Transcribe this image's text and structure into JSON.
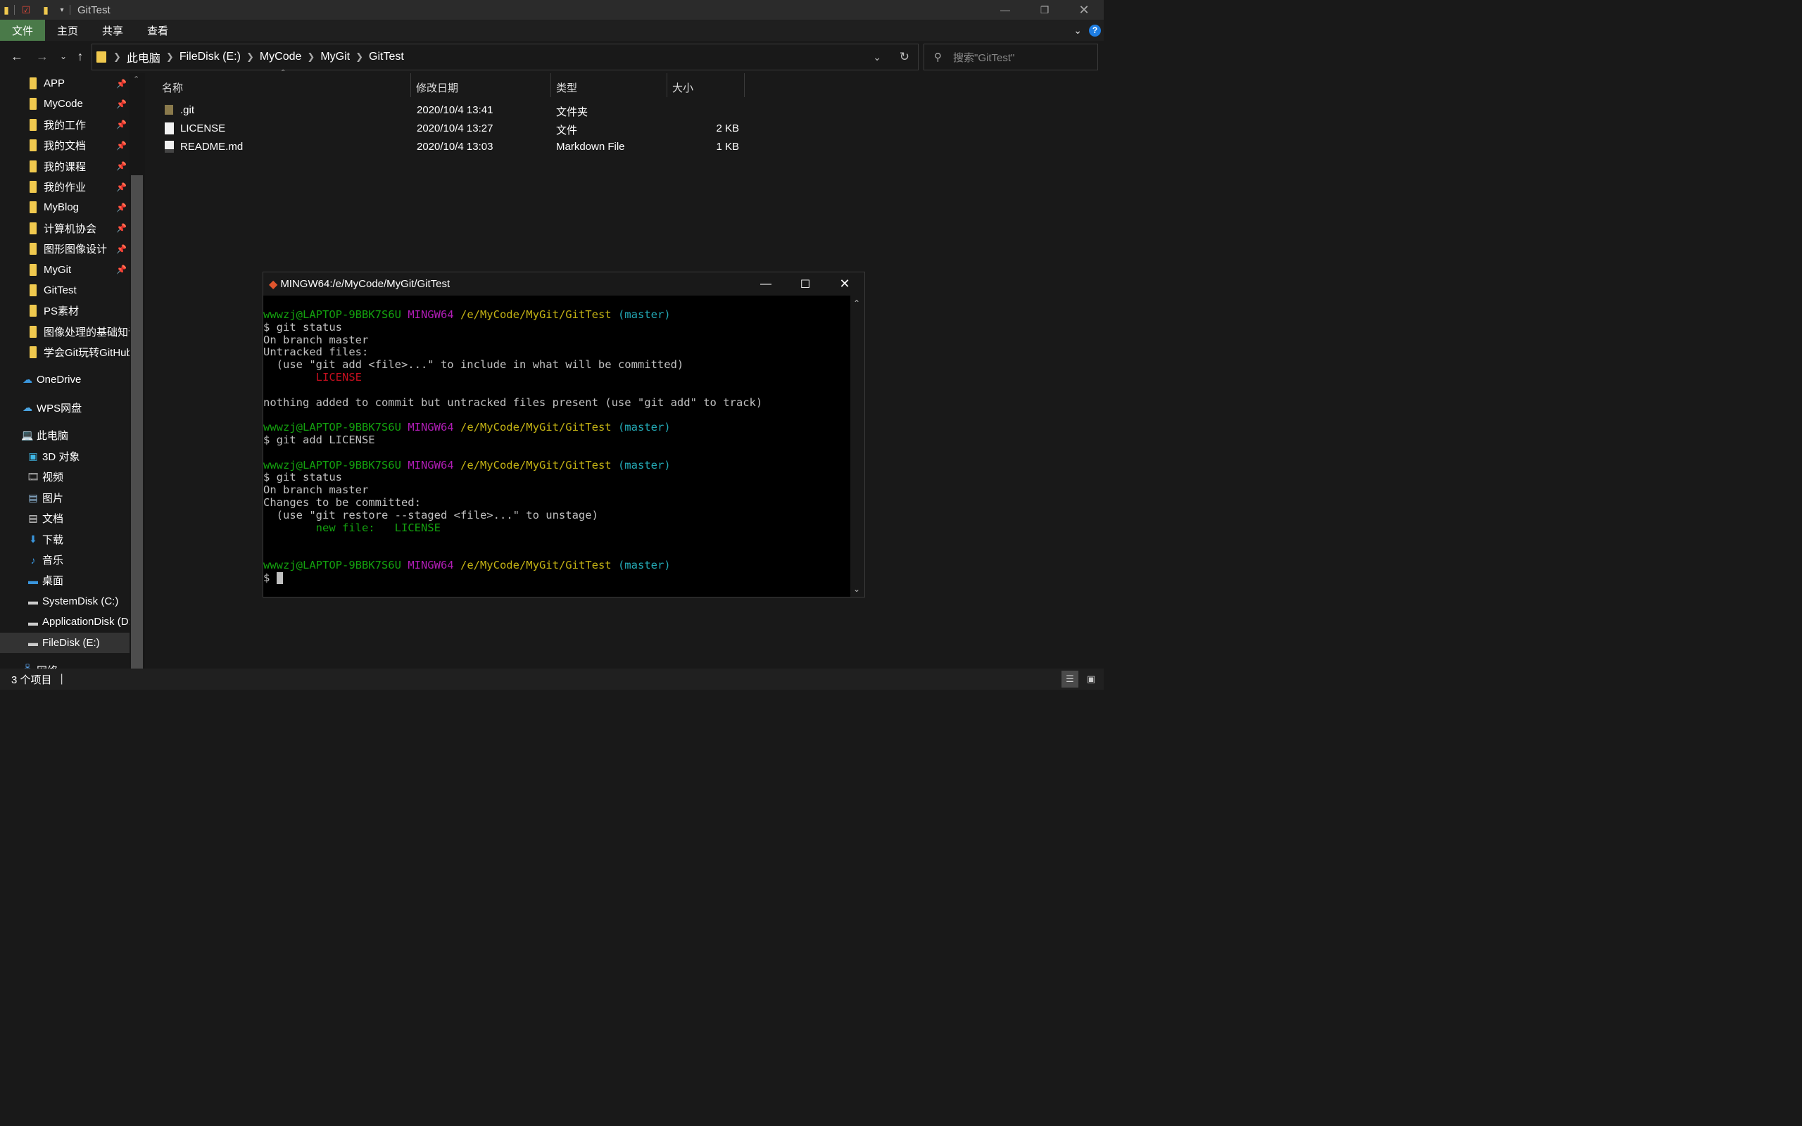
{
  "window": {
    "title": "GitTest",
    "controls": [
      "minimize-icon",
      "restore-icon",
      "close-icon"
    ]
  },
  "ribbon": {
    "tabs": [
      {
        "label": "文件",
        "active": true
      },
      {
        "label": "主页",
        "active": false
      },
      {
        "label": "共享",
        "active": false
      },
      {
        "label": "查看",
        "active": false
      }
    ]
  },
  "address": {
    "crumbs": [
      "此电脑",
      "FileDisk (E:)",
      "MyCode",
      "MyGit",
      "GitTest"
    ],
    "search_placeholder": "搜索\"GitTest\""
  },
  "sidebar": {
    "quick_access": [
      {
        "label": "APP",
        "pinned": true
      },
      {
        "label": "MyCode",
        "pinned": true
      },
      {
        "label": "我的工作",
        "pinned": true
      },
      {
        "label": "我的文档",
        "pinned": true
      },
      {
        "label": "我的课程",
        "pinned": true
      },
      {
        "label": "我的作业",
        "pinned": true
      },
      {
        "label": "MyBlog",
        "pinned": true
      },
      {
        "label": "计算机协会",
        "pinned": true
      },
      {
        "label": "图形图像设计",
        "pinned": true
      },
      {
        "label": "MyGit",
        "pinned": true
      },
      {
        "label": "GitTest",
        "pinned": false
      },
      {
        "label": "PS素材",
        "pinned": false
      },
      {
        "label": "图像处理的基础知识",
        "pinned": false
      },
      {
        "label": "学会Git玩转GitHub",
        "pinned": false
      }
    ],
    "onedrive": "OneDrive",
    "wps": "WPS网盘",
    "this_pc": "此电脑",
    "pc_items": [
      {
        "label": "3D 对象",
        "icon": "cube-3d-icon"
      },
      {
        "label": "视频",
        "icon": "video-icon"
      },
      {
        "label": "图片",
        "icon": "picture-icon"
      },
      {
        "label": "文档",
        "icon": "document-icon"
      },
      {
        "label": "下载",
        "icon": "download-icon"
      },
      {
        "label": "音乐",
        "icon": "music-icon"
      },
      {
        "label": "桌面",
        "icon": "desktop-icon"
      },
      {
        "label": "SystemDisk (C:)",
        "icon": "drive-icon"
      },
      {
        "label": "ApplicationDisk (D:)",
        "icon": "drive-icon"
      },
      {
        "label": "FileDisk (E:)",
        "icon": "drive-icon",
        "selected": true
      }
    ],
    "network": "网络"
  },
  "filelist": {
    "headers": {
      "name": "名称",
      "date": "修改日期",
      "type": "类型",
      "size": "大小"
    },
    "rows": [
      {
        "name": ".git",
        "date": "2020/10/4 13:41",
        "type": "文件夹",
        "size": "",
        "icon": "folder-icon"
      },
      {
        "name": "LICENSE",
        "date": "2020/10/4 13:27",
        "type": "文件",
        "size": "2 KB",
        "icon": "file-icon"
      },
      {
        "name": "README.md",
        "date": "2020/10/4 13:03",
        "type": "Markdown File",
        "size": "1 KB",
        "icon": "markdown-file-icon"
      }
    ]
  },
  "terminal": {
    "title": "MINGW64:/e/MyCode/MyGit/GitTest",
    "prompt": {
      "user": "wwwzj@LAPTOP-9BBK7S6U",
      "env": "MINGW64",
      "path": "/e/MyCode/MyGit/GitTest",
      "branch": "(master)"
    },
    "lines": [
      {
        "kind": "prompt"
      },
      {
        "kind": "text",
        "text": "$ git status"
      },
      {
        "kind": "text",
        "text": "On branch master"
      },
      {
        "kind": "text",
        "text": "Untracked files:"
      },
      {
        "kind": "text",
        "text": "  (use \"git add <file>...\" to include in what will be committed)"
      },
      {
        "kind": "red",
        "text": "        LICENSE"
      },
      {
        "kind": "text",
        "text": ""
      },
      {
        "kind": "text",
        "text": "nothing added to commit but untracked files present (use \"git add\" to track)"
      },
      {
        "kind": "text",
        "text": ""
      },
      {
        "kind": "prompt"
      },
      {
        "kind": "text",
        "text": "$ git add LICENSE"
      },
      {
        "kind": "text",
        "text": ""
      },
      {
        "kind": "prompt"
      },
      {
        "kind": "text",
        "text": "$ git status"
      },
      {
        "kind": "text",
        "text": "On branch master"
      },
      {
        "kind": "text",
        "text": "Changes to be committed:"
      },
      {
        "kind": "text",
        "text": "  (use \"git restore --staged <file>...\" to unstage)"
      },
      {
        "kind": "green",
        "text": "        new file:   LICENSE"
      },
      {
        "kind": "text",
        "text": ""
      },
      {
        "kind": "text",
        "text": ""
      },
      {
        "kind": "prompt"
      },
      {
        "kind": "cursor",
        "text": "$ "
      }
    ]
  },
  "status": {
    "item_count": "3 个项目"
  },
  "colors": {
    "accent_ribbon": "#4a7a49",
    "folder": "#f0c94e",
    "term_green": "#13a10e",
    "term_magenta": "#b01db5",
    "term_yellow": "#c4b314",
    "term_cyan": "#23a9b5",
    "term_red": "#c50f1f"
  }
}
